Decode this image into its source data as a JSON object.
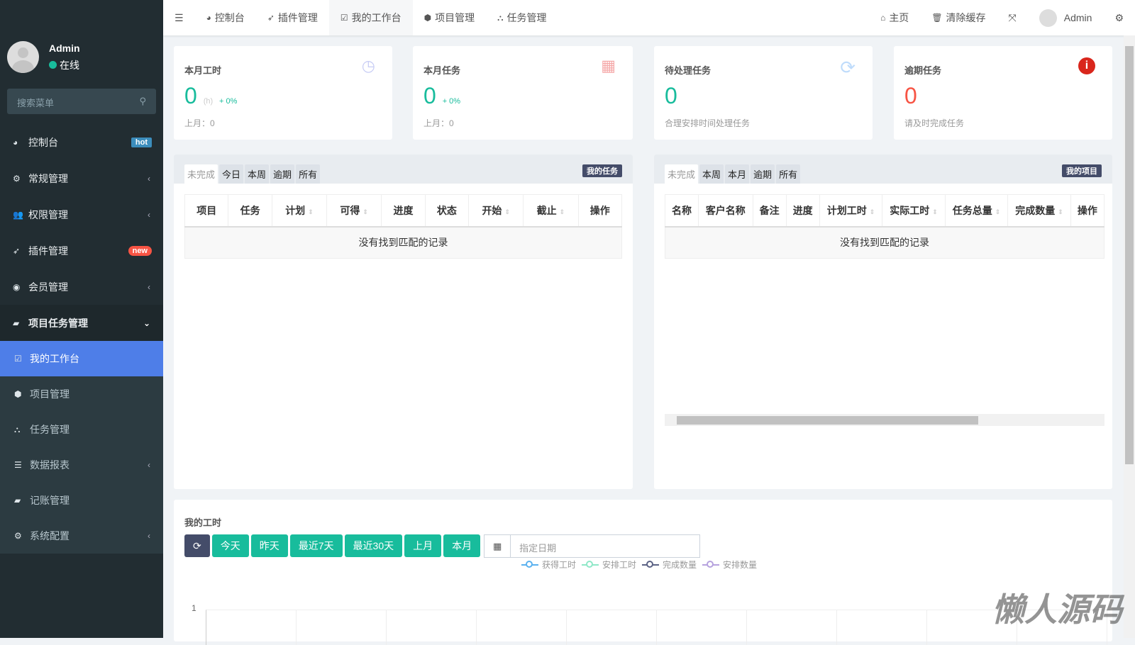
{
  "sidebar": {
    "user": "Admin",
    "status": "在线",
    "search_placeholder": "搜索菜单",
    "items": [
      {
        "label": "控制台",
        "badge": "hot"
      },
      {
        "label": "常规管理"
      },
      {
        "label": "权限管理"
      },
      {
        "label": "插件管理",
        "badge": "new"
      },
      {
        "label": "会员管理"
      },
      {
        "label": "项目任务管理"
      }
    ],
    "sub": [
      {
        "label": "我的工作台"
      },
      {
        "label": "项目管理"
      },
      {
        "label": "任务管理"
      },
      {
        "label": "数据报表"
      },
      {
        "label": "记账管理"
      },
      {
        "label": "系统配置"
      }
    ]
  },
  "topbar": {
    "tabs": [
      "控制台",
      "插件管理",
      "我的工作台",
      "项目管理",
      "任务管理"
    ],
    "home": "主页",
    "clear_cache": "清除缓存",
    "user": "Admin"
  },
  "cards": [
    {
      "title": "本月工时",
      "value": "0",
      "unit": "(h)",
      "change": "+ 0%",
      "sub": "上月：0"
    },
    {
      "title": "本月任务",
      "value": "0",
      "change": "+ 0%",
      "sub": "上月：0"
    },
    {
      "title": "待处理任务",
      "value": "0",
      "sub": "合理安排时间处理任务"
    },
    {
      "title": "逾期任务",
      "value": "0",
      "sub": "请及时完成任务"
    }
  ],
  "tasks": {
    "tabs": [
      "未完成",
      "今日",
      "本周",
      "逾期",
      "所有"
    ],
    "tag": "我的任务",
    "columns": [
      "项目",
      "任务",
      "计划",
      "可得",
      "进度",
      "状态",
      "开始",
      "截止",
      "操作"
    ],
    "empty": "没有找到匹配的记录"
  },
  "projects": {
    "tabs": [
      "未完成",
      "本周",
      "本月",
      "逾期",
      "所有"
    ],
    "tag": "我的项目",
    "columns": [
      "名称",
      "客户名称",
      "备注",
      "进度",
      "计划工时",
      "实际工时",
      "任务总量",
      "完成数量",
      "操作"
    ],
    "empty": "没有找到匹配的记录"
  },
  "hours": {
    "title": "我的工时",
    "buttons": [
      "今天",
      "昨天",
      "最近7天",
      "最近30天",
      "上月",
      "本月"
    ],
    "date_placeholder": "指定日期",
    "legend": [
      {
        "name": "获得工时",
        "color": "#5ab1ef"
      },
      {
        "name": "安排工时",
        "color": "#8fe8c8"
      },
      {
        "name": "完成数量",
        "color": "#5b6284"
      },
      {
        "name": "安排数量",
        "color": "#b6a2de"
      }
    ],
    "y_max_label": "1"
  },
  "watermark": "懒人源码"
}
